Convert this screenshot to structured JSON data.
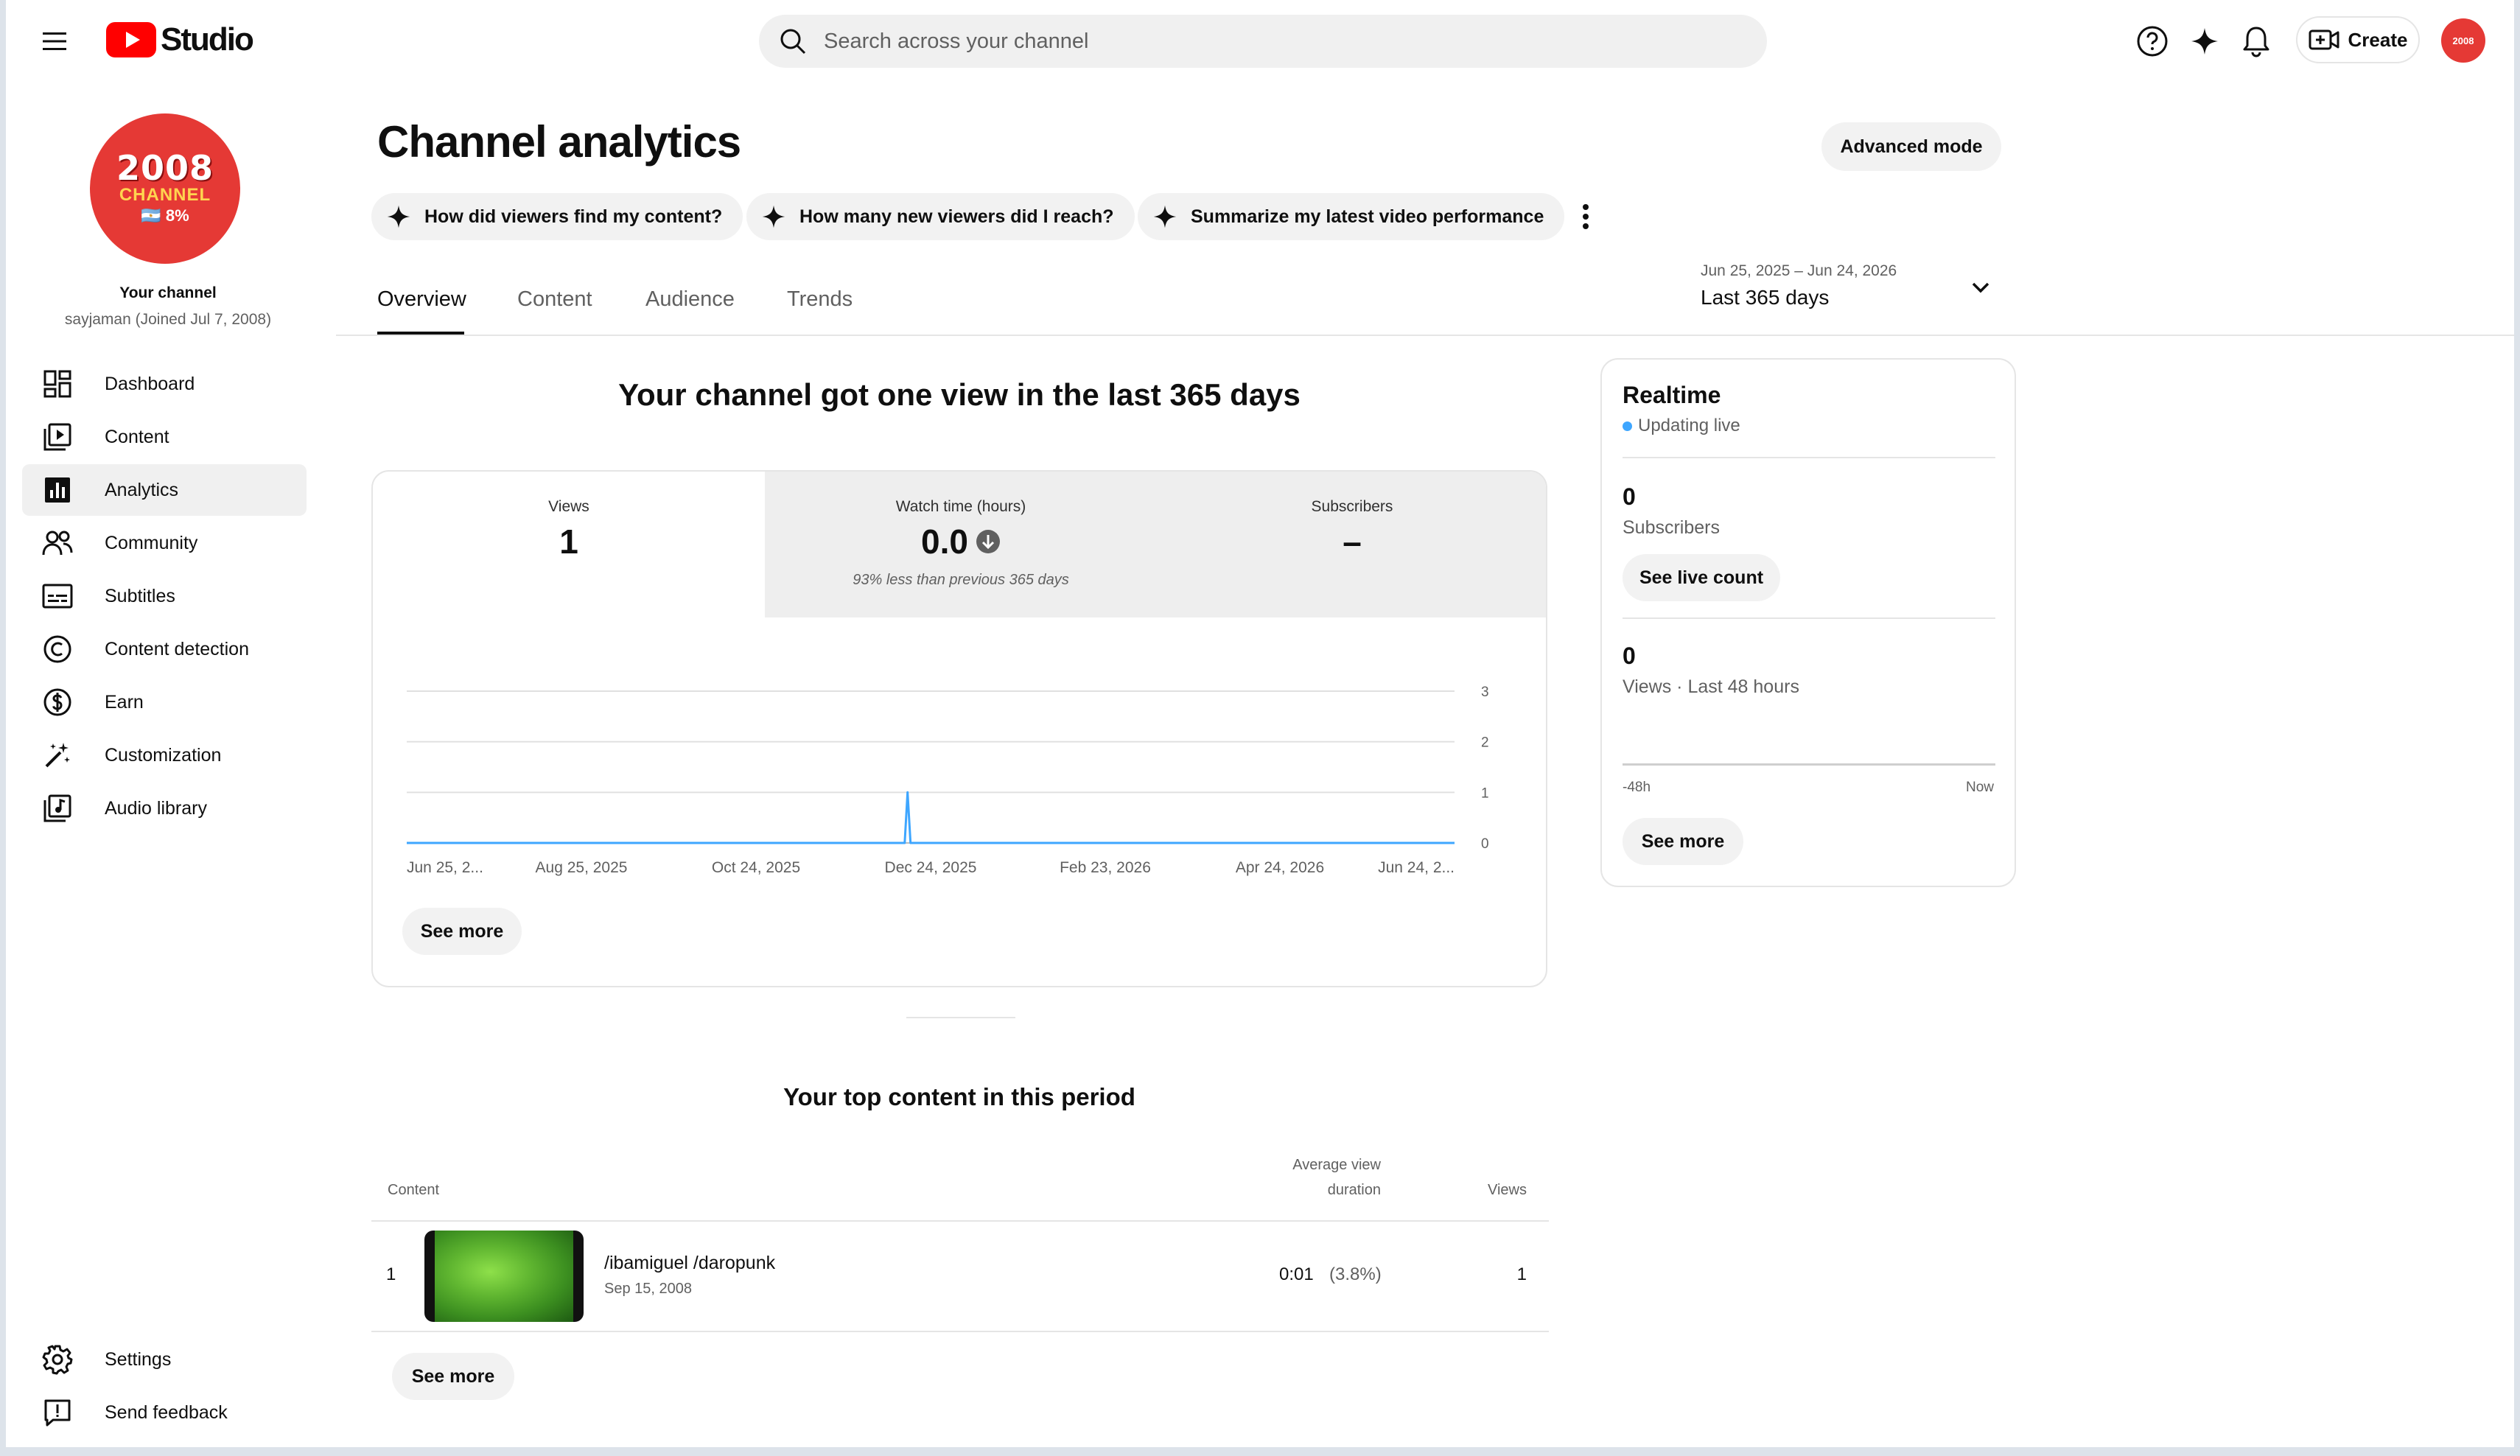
{
  "app": {
    "logo_text": "Studio"
  },
  "search": {
    "placeholder": "Search across your channel"
  },
  "header": {
    "create_label": "Create"
  },
  "channel": {
    "avatar_line1": "2008",
    "avatar_line2": "CHANNEL",
    "avatar_line3": "🇦🇷 8%",
    "your_channel_label": "Your channel",
    "handle": "sayjaman (Joined Jul 7, 2008)"
  },
  "sidebar": {
    "items": [
      {
        "label": "Dashboard",
        "icon": "dashboard-icon"
      },
      {
        "label": "Content",
        "icon": "content-icon"
      },
      {
        "label": "Analytics",
        "icon": "analytics-icon"
      },
      {
        "label": "Community",
        "icon": "community-icon"
      },
      {
        "label": "Subtitles",
        "icon": "subtitles-icon"
      },
      {
        "label": "Content detection",
        "icon": "copyright-icon"
      },
      {
        "label": "Earn",
        "icon": "dollar-icon"
      },
      {
        "label": "Customization",
        "icon": "magic-wand-icon"
      },
      {
        "label": "Audio library",
        "icon": "audio-library-icon"
      }
    ],
    "bottom_items": [
      {
        "label": "Settings",
        "icon": "gear-icon"
      },
      {
        "label": "Send feedback",
        "icon": "feedback-icon"
      }
    ]
  },
  "page": {
    "title": "Channel analytics",
    "advanced_mode_label": "Advanced mode",
    "chips": [
      "How did viewers find my content?",
      "How many new viewers did I reach?",
      "Summarize my latest video performance"
    ],
    "tabs": [
      "Overview",
      "Content",
      "Audience",
      "Trends"
    ],
    "date_range": {
      "range": "Jun 25, 2025 – Jun 24, 2026",
      "label": "Last 365 days"
    },
    "headline": "Your channel got one view in the last 365 days"
  },
  "metrics": [
    {
      "label": "Views",
      "value": "1",
      "note": ""
    },
    {
      "label": "Watch time (hours)",
      "value": "0.0",
      "note": "93% less than previous 365 days"
    },
    {
      "label": "Subscribers",
      "value": "–",
      "note": ""
    }
  ],
  "chart_data": {
    "type": "line",
    "x_tick_labels": [
      "Jun 25, 2...",
      "Aug 25, 2025",
      "Oct 24, 2025",
      "Dec 24, 2025",
      "Feb 23, 2026",
      "Apr 24, 2026",
      "Jun 24, 2..."
    ],
    "y_tick_labels": [
      "3",
      "2",
      "1",
      "0"
    ],
    "ylim": [
      0,
      3
    ],
    "x_start": "2025-06-25",
    "x_end": "2026-06-24",
    "series": [
      {
        "values": [
          {
            "x": "2025-06-25",
            "y": 0
          },
          {
            "x": "2025-12-15",
            "y": 0
          },
          {
            "x": "2025-12-16",
            "y": 1
          },
          {
            "x": "2025-12-17",
            "y": 0
          },
          {
            "x": "2026-06-24",
            "y": 0
          }
        ]
      }
    ],
    "grid": true,
    "color": "#3ea6ff"
  },
  "overview": {
    "see_more_label": "See more"
  },
  "realtime": {
    "title": "Realtime",
    "status": "Updating live",
    "subscribers_value": "0",
    "subscribers_label": "Subscribers",
    "see_live_count_label": "See live count",
    "views_value": "0",
    "views_label": "Views · Last 48 hours",
    "axis_start": "-48h",
    "axis_end": "Now",
    "see_more_label": "See more"
  },
  "top_content": {
    "title": "Your top content in this period",
    "headers": {
      "content": "Content",
      "avg_view_duration_1": "Average view",
      "avg_view_duration_2": "duration",
      "views": "Views"
    },
    "rows": [
      {
        "rank": "1",
        "title": "/ibamiguel /daropunk",
        "date": "Sep 15, 2008",
        "avg_duration": "0:01",
        "avg_pct": "(3.8%)",
        "views": "1"
      }
    ],
    "see_more_label": "See more"
  }
}
